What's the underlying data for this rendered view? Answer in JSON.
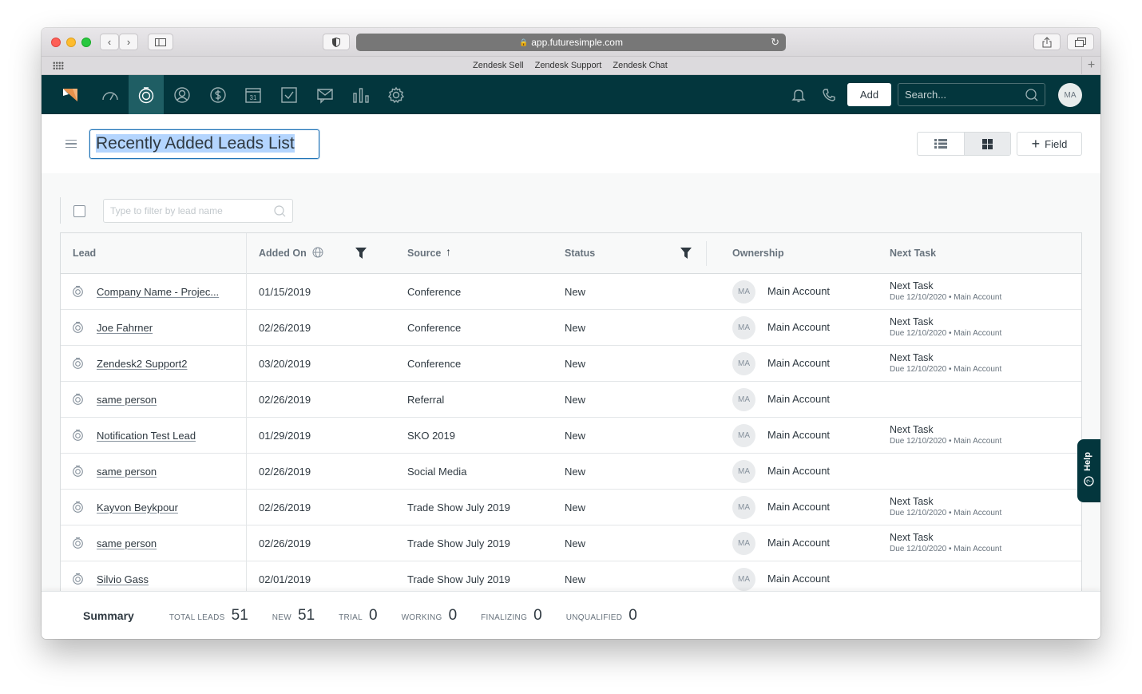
{
  "browser": {
    "url": "app.futuresimple.com",
    "bookmarks": [
      "Zendesk Sell",
      "Zendesk Support",
      "Zendesk Chat"
    ]
  },
  "nav": {
    "icons": [
      "gauge-icon",
      "leads-icon",
      "contacts-icon",
      "deals-icon",
      "calendar-icon",
      "tasks-icon",
      "communication-icon",
      "reports-icon",
      "settings-icon"
    ],
    "calendar_day": "31",
    "add_label": "Add",
    "search_placeholder": "Search...",
    "avatar_initials": "MA",
    "accent": "#03363d"
  },
  "page": {
    "title": "Recently Added Leads List",
    "field_button": "Field"
  },
  "filter": {
    "placeholder": "Type to filter by lead name"
  },
  "table": {
    "headers": [
      "Lead",
      "Added On",
      "Source",
      "Status",
      "Ownership",
      "Next Task"
    ],
    "rows": [
      {
        "lead": "Company Name - Projec...",
        "added": "01/15/2019",
        "source": "Conference",
        "status": "New",
        "owner_initials": "MA",
        "owner": "Main Account",
        "task": "Next Task",
        "task_sub": "Due 12/10/2020 • Main Account"
      },
      {
        "lead": "Joe Fahrner",
        "added": "02/26/2019",
        "source": "Conference",
        "status": "New",
        "owner_initials": "MA",
        "owner": "Main Account",
        "task": "Next Task",
        "task_sub": "Due 12/10/2020 • Main Account"
      },
      {
        "lead": "Zendesk2 Support2",
        "added": "03/20/2019",
        "source": "Conference",
        "status": "New",
        "owner_initials": "MA",
        "owner": "Main Account",
        "task": "Next Task",
        "task_sub": "Due 12/10/2020 • Main Account"
      },
      {
        "lead": "same person",
        "added": "02/26/2019",
        "source": "Referral",
        "status": "New",
        "owner_initials": "MA",
        "owner": "Main Account",
        "task": "",
        "task_sub": ""
      },
      {
        "lead": "Notification Test Lead",
        "added": "01/29/2019",
        "source": "SKO 2019",
        "status": "New",
        "owner_initials": "MA",
        "owner": "Main Account",
        "task": "Next Task",
        "task_sub": "Due 12/10/2020 • Main Account"
      },
      {
        "lead": "same person",
        "added": "02/26/2019",
        "source": "Social Media",
        "status": "New",
        "owner_initials": "MA",
        "owner": "Main Account",
        "task": "",
        "task_sub": ""
      },
      {
        "lead": "Kayvon Beykpour",
        "added": "02/26/2019",
        "source": "Trade Show July 2019",
        "status": "New",
        "owner_initials": "MA",
        "owner": "Main Account",
        "task": "Next Task",
        "task_sub": "Due 12/10/2020 • Main Account"
      },
      {
        "lead": "same person",
        "added": "02/26/2019",
        "source": "Trade Show July 2019",
        "status": "New",
        "owner_initials": "MA",
        "owner": "Main Account",
        "task": "Next Task",
        "task_sub": "Due 12/10/2020 • Main Account"
      },
      {
        "lead": "Silvio Gass",
        "added": "02/01/2019",
        "source": "Trade Show July 2019",
        "status": "New",
        "owner_initials": "MA",
        "owner": "Main Account",
        "task": "",
        "task_sub": ""
      }
    ]
  },
  "summary": {
    "label": "Summary",
    "stats": [
      {
        "key": "TOTAL LEADS",
        "value": "51"
      },
      {
        "key": "NEW",
        "value": "51"
      },
      {
        "key": "TRIAL",
        "value": "0"
      },
      {
        "key": "WORKING",
        "value": "0"
      },
      {
        "key": "FINALIZING",
        "value": "0"
      },
      {
        "key": "UNQUALIFIED",
        "value": "0"
      }
    ]
  },
  "help": {
    "label": "Help"
  }
}
